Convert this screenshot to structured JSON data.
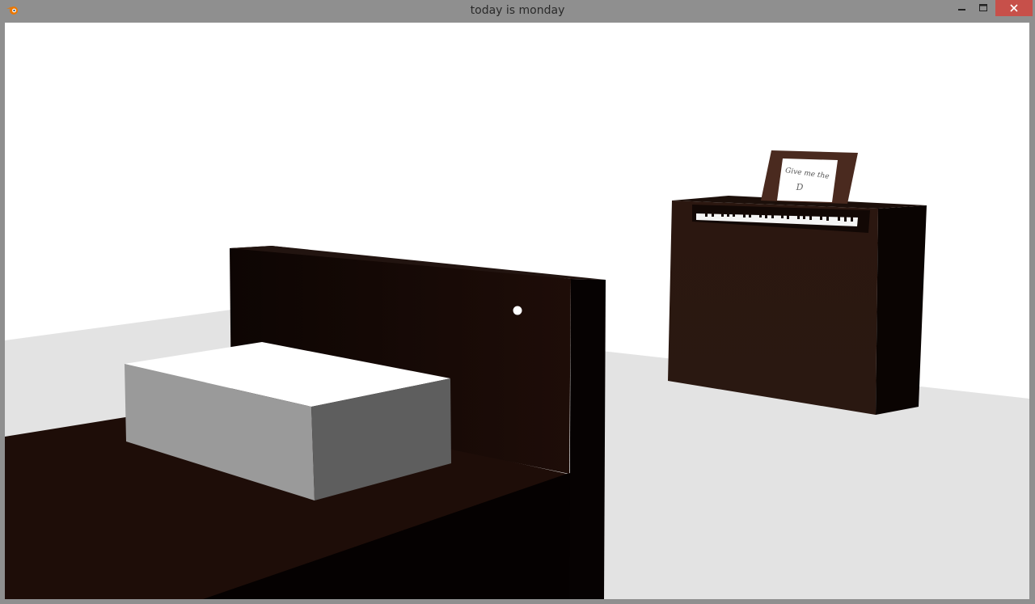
{
  "window": {
    "title": "today is monday",
    "app_icon": "blender-icon",
    "controls": {
      "minimize": "minimize-icon",
      "maximize": "maximize-icon",
      "close": "close-icon"
    }
  },
  "scene": {
    "frame_caption_line1": "Give me the",
    "frame_caption_line2": "D",
    "colors": {
      "sky": "#ffffff",
      "floor": "#e3e3e3",
      "dark_wood": "#140804",
      "bed_frame": "#1e0e08",
      "piano": "#2a1710",
      "frame": "#4a2a1f",
      "close_button": "#c7504a"
    }
  }
}
